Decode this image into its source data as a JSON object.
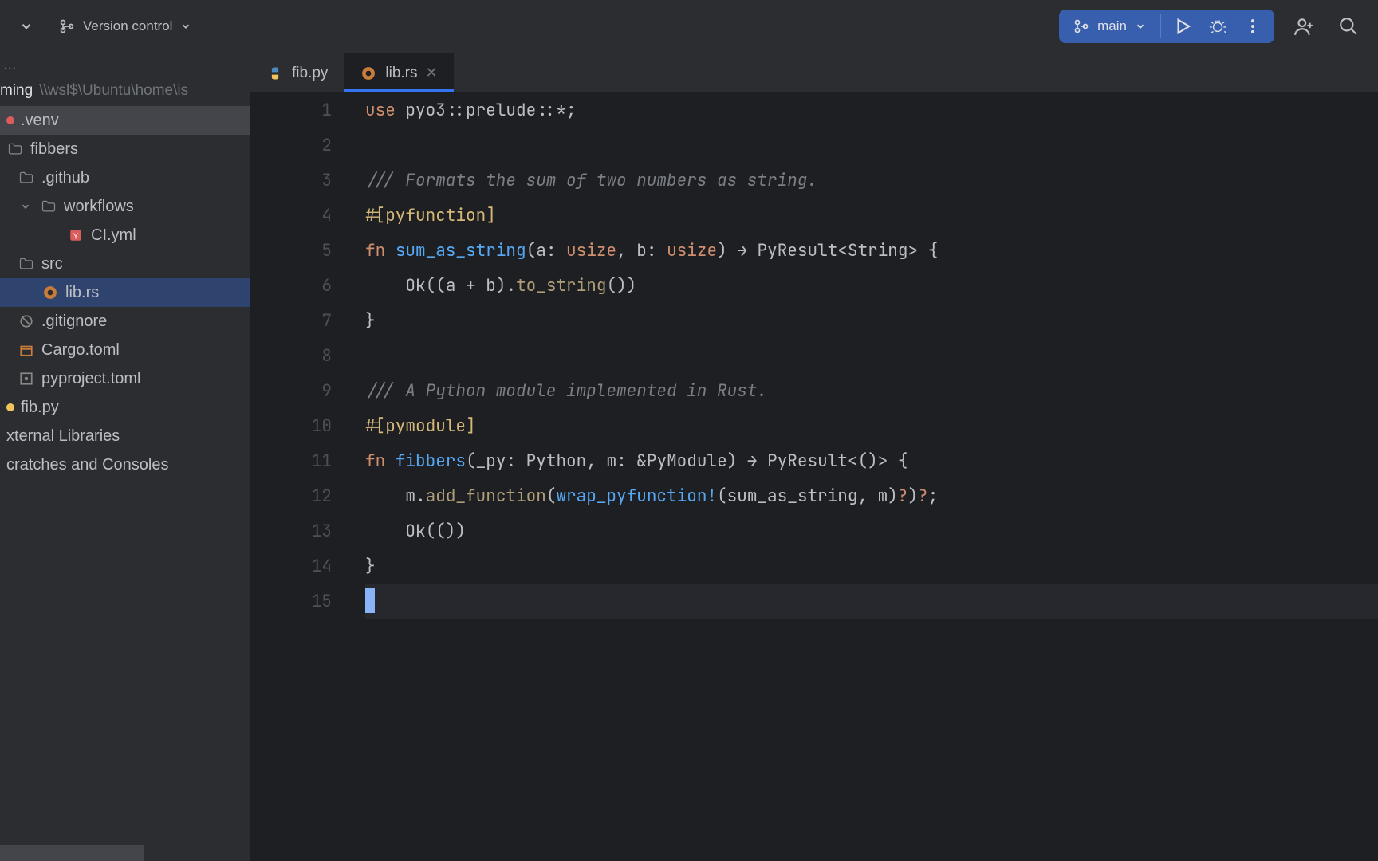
{
  "toolbar": {
    "version_control_label": "Version control",
    "branch_label": "main"
  },
  "tabs": [
    {
      "label": "fib.py",
      "active": false,
      "closeable": false
    },
    {
      "label": "lib.rs",
      "active": true,
      "closeable": true
    }
  ],
  "project": {
    "root_suffix": "ming",
    "root_path": "\\\\wsl$\\Ubuntu\\home\\is",
    "tree": [
      {
        "label": ".venv",
        "kind": "venv",
        "depth": 0
      },
      {
        "label": "fibbers",
        "kind": "folder-open",
        "depth": 0
      },
      {
        "label": ".github",
        "kind": "folder-open",
        "depth": 1
      },
      {
        "label": "workflows",
        "kind": "folder-open",
        "depth": 2
      },
      {
        "label": "CI.yml",
        "kind": "yaml",
        "depth": 3
      },
      {
        "label": "src",
        "kind": "folder-open",
        "depth": 1
      },
      {
        "label": "lib.rs",
        "kind": "rust",
        "depth": 2,
        "selected": true
      },
      {
        "label": ".gitignore",
        "kind": "gitignore",
        "depth": 1
      },
      {
        "label": "Cargo.toml",
        "kind": "cargo",
        "depth": 1
      },
      {
        "label": "pyproject.toml",
        "kind": "toml",
        "depth": 1
      },
      {
        "label": "fib.py",
        "kind": "python",
        "depth": 0
      },
      {
        "label": "xternal Libraries",
        "kind": "lib",
        "depth": -1
      },
      {
        "label": "cratches and Consoles",
        "kind": "scratch",
        "depth": -1
      }
    ]
  },
  "editor": {
    "cursor_line": 15,
    "lines": [
      "use pyo3::prelude::*;",
      "",
      "/// Formats the sum of two numbers as string.",
      "#[pyfunction]",
      "fn sum_as_string(a: usize, b: usize) → PyResult<String> {",
      "    Ok((a + b).to_string())",
      "}",
      "",
      "/// A Python module implemented in Rust.",
      "#[pymodule]",
      "fn fibbers(_py: Python, m: &PyModule) → PyResult<()> {",
      "    m.add_function(wrap_pyfunction!(sum_as_string, m)?)?;",
      "    Ok(())",
      "}",
      ""
    ]
  },
  "gutter": {
    "count": 15
  },
  "tokens": {
    "use": "use",
    "pyo3": "pyo3",
    "prelude": "prelude",
    "star": "*",
    "semi": ";",
    "c1": "/// Formats the sum of two numbers as string.",
    "attr1": "#[pyfunction]",
    "fn": "fn",
    "sum_as_string": "sum_as_string",
    "a": "a",
    "b": "b",
    "usize": "usize",
    "arrow": "→",
    "PyResult": "PyResult",
    "String": "String",
    "Ok": "Ok",
    "to_string": "to_string",
    "c2": "/// A Python module implemented in Rust.",
    "attr2": "#[pymodule]",
    "fibbers": "fibbers",
    "_py": "_py",
    "Python": "Python",
    "m": "m",
    "PyModule": "&PyModule",
    "add_function": "add_function",
    "wrap_pyfunction": "wrap_pyfunction!",
    "q": "?"
  }
}
